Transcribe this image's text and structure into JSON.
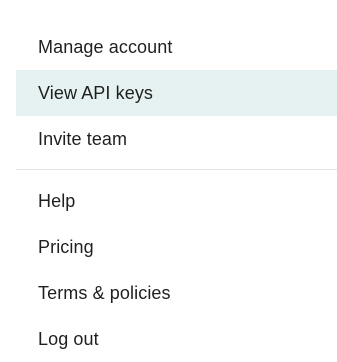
{
  "menu": {
    "account_items": [
      {
        "label": "Manage account",
        "active": false
      },
      {
        "label": "View API keys",
        "active": true
      },
      {
        "label": "Invite team",
        "active": false
      }
    ],
    "support_items": [
      {
        "label": "Help"
      },
      {
        "label": "Pricing"
      },
      {
        "label": "Terms & policies"
      },
      {
        "label": "Log out"
      }
    ],
    "highlight_color": "#e6f1f1",
    "text_color": "#1f1f1f"
  }
}
